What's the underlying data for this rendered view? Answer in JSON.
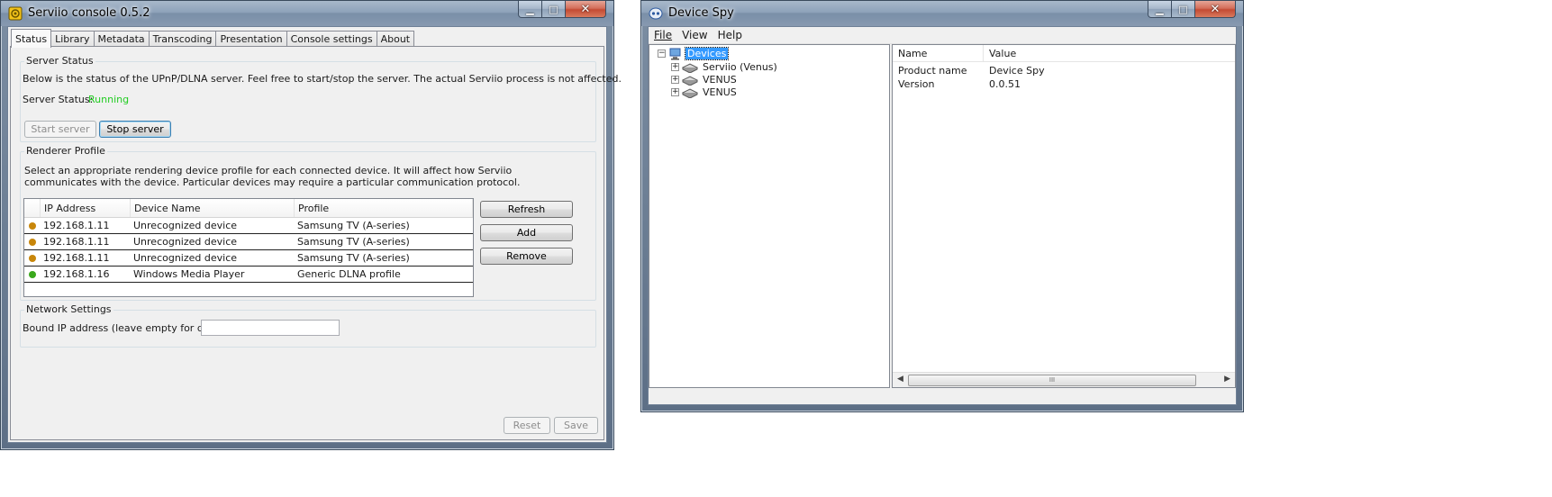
{
  "serviio": {
    "title": "Serviio console 0.5.2",
    "tabs": [
      "Status",
      "Library",
      "Metadata",
      "Transcoding",
      "Presentation",
      "Console settings",
      "About"
    ],
    "active_tab": "Status",
    "server_status": {
      "group_title": "Server Status",
      "description": "Below is the status of the UPnP/DLNA server. Feel free to start/stop the server. The actual Serviio process is not affected.",
      "status_label": "Server Status:",
      "status_value": "Running",
      "status_color": "#22cc22",
      "start_button": "Start server",
      "stop_button": "Stop server"
    },
    "renderer_profile": {
      "group_title": "Renderer Profile",
      "description": "Select an appropriate rendering device profile for each connected device. It will affect how Serviio communicates with the device. Particular devices may require a particular communication protocol.",
      "columns": [
        "IP Address",
        "Device Name",
        "Profile"
      ],
      "rows": [
        {
          "status_color": "#c8860a",
          "ip": "192.168.1.11",
          "device": "Unrecognized device",
          "profile": "Samsung TV (A-series)"
        },
        {
          "status_color": "#c8860a",
          "ip": "192.168.1.11",
          "device": "Unrecognized device",
          "profile": "Samsung TV (A-series)"
        },
        {
          "status_color": "#c8860a",
          "ip": "192.168.1.11",
          "device": "Unrecognized device",
          "profile": "Samsung TV (A-series)"
        },
        {
          "status_color": "#3aa81c",
          "ip": "192.168.1.16",
          "device": "Windows Media Player",
          "profile": "Generic DLNA profile"
        }
      ],
      "refresh_button": "Refresh",
      "add_button": "Add",
      "remove_button": "Remove"
    },
    "network_settings": {
      "group_title": "Network Settings",
      "bound_ip_label": "Bound IP address (leave empty for default):",
      "bound_ip_value": ""
    },
    "reset_button": "Reset",
    "save_button": "Save"
  },
  "device_spy": {
    "title": "Device Spy",
    "menu": [
      "File",
      "View",
      "Help"
    ],
    "tree": {
      "root": "Devices",
      "children": [
        "Serviio (Venus)",
        "VENUS",
        "VENUS"
      ]
    },
    "properties": {
      "columns": [
        "Name",
        "Value"
      ],
      "rows": [
        {
          "name": "Product name",
          "value": "Device Spy"
        },
        {
          "name": "Version",
          "value": "0.0.51"
        }
      ]
    },
    "scroll_thumb_glyph": "III"
  },
  "window_controls": {
    "minimize": "▁",
    "maximize": "□",
    "close": "✕"
  }
}
